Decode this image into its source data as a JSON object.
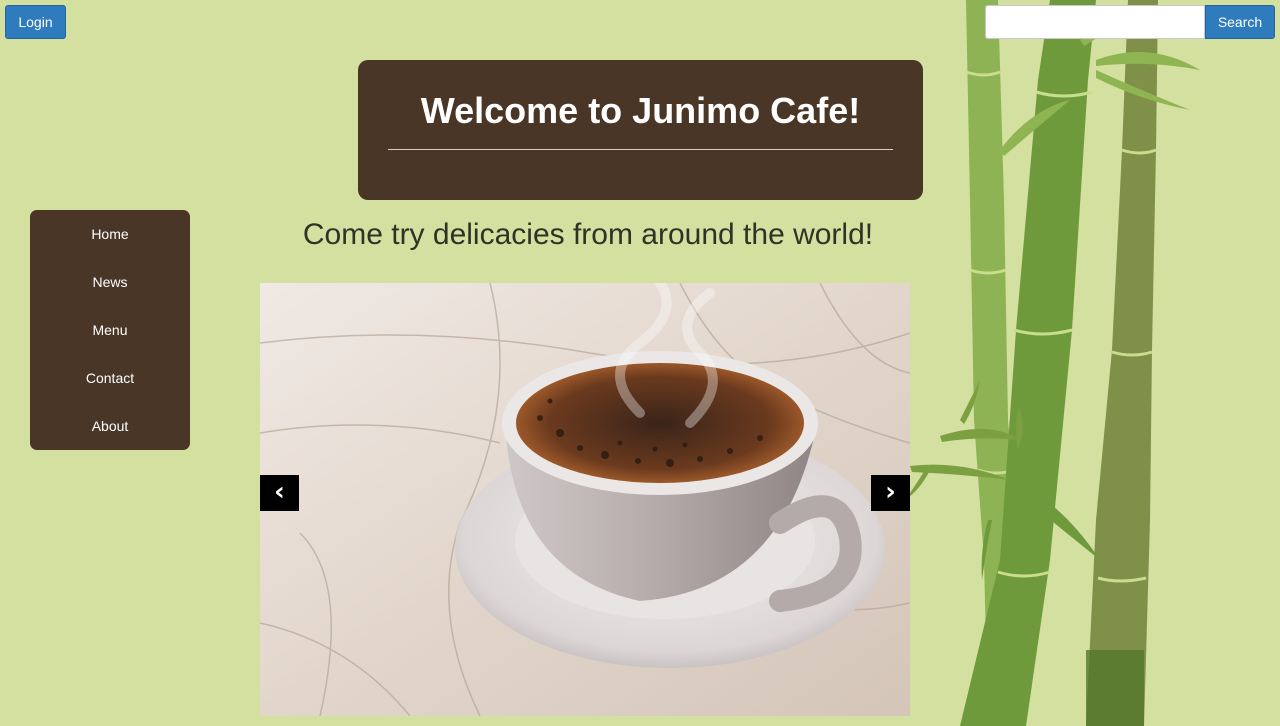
{
  "header": {
    "login_label": "Login",
    "search_placeholder": "",
    "search_label": "Search"
  },
  "hero": {
    "title": "Welcome to Junimo Cafe!"
  },
  "nav": {
    "items": [
      {
        "label": "Home"
      },
      {
        "label": "News"
      },
      {
        "label": "Menu"
      },
      {
        "label": "Contact"
      },
      {
        "label": "About"
      }
    ]
  },
  "main": {
    "tagline": "Come try delicacies from around the world!"
  },
  "carousel": {
    "prev_label": "‹",
    "next_label": "›",
    "image": "steaming-coffee-cup-on-saucer"
  },
  "colors": {
    "page_background": "#d3e09f",
    "panel_brown": "#4a3626",
    "button_blue": "#2e7bbd",
    "bamboo_green": "#6f9a3c"
  }
}
